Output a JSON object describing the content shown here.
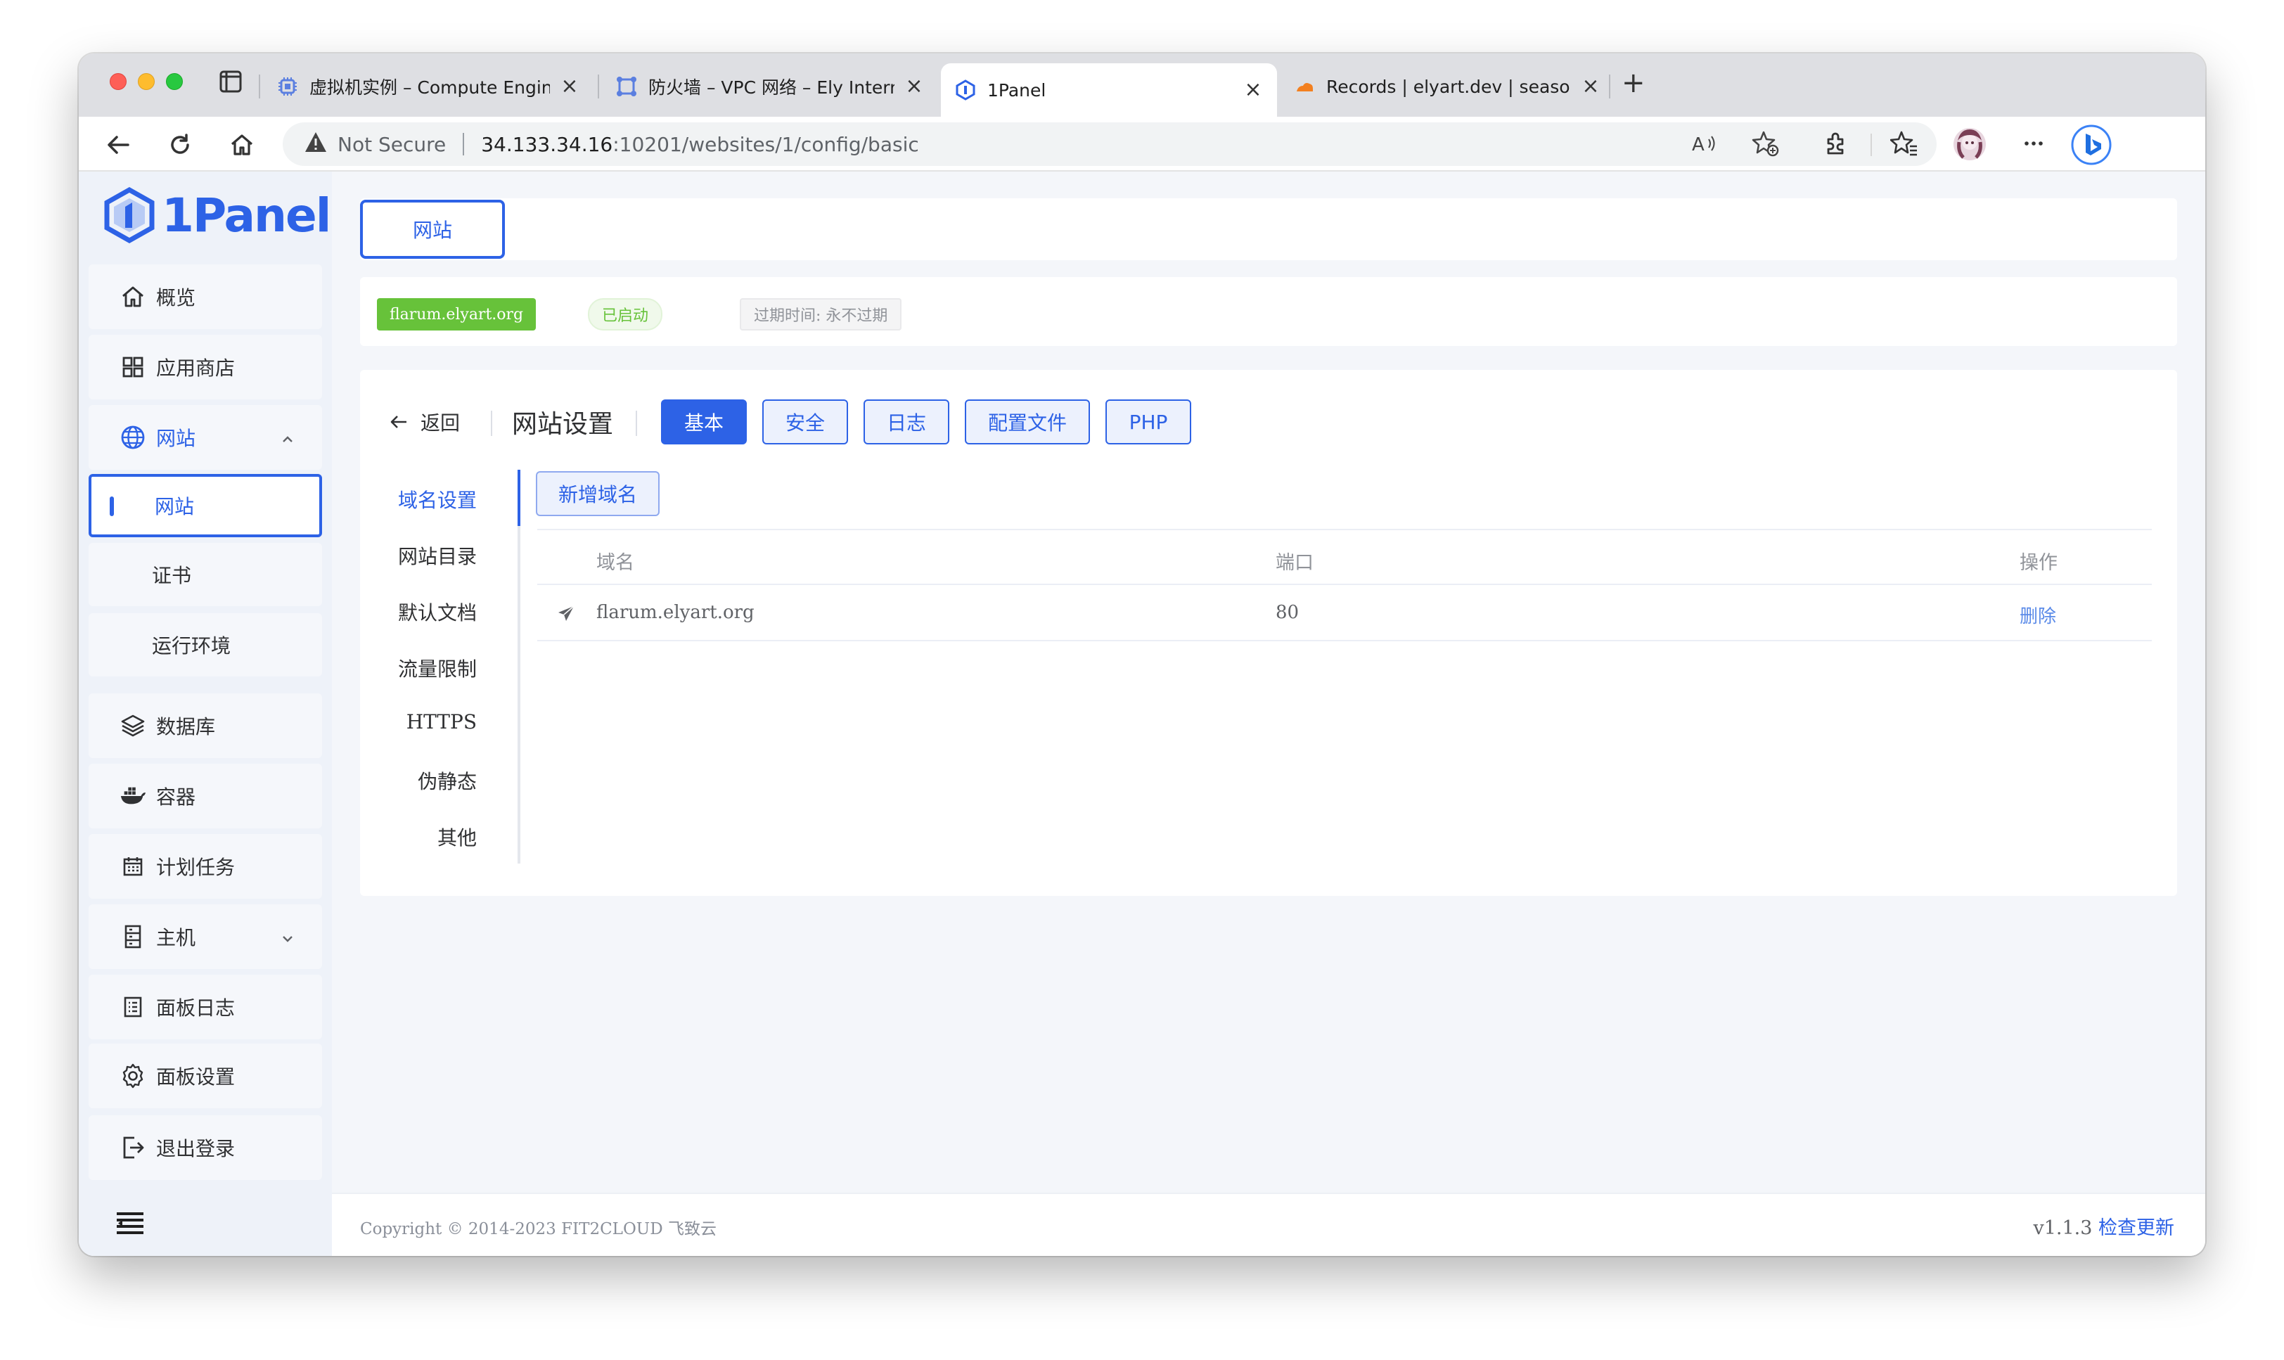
{
  "browser": {
    "tabs": [
      {
        "title": "虚拟机实例 – Compute Engine –",
        "icon": "compute-engine-icon"
      },
      {
        "title": "防火墙 – VPC 网络 – Ely Interna",
        "icon": "vpc-network-icon"
      },
      {
        "title": "1Panel",
        "icon": "1panel-icon"
      },
      {
        "title": "Records | elyart.dev | seasonsh",
        "icon": "cloudflare-icon"
      }
    ],
    "address": {
      "security_label": "Not Secure",
      "host": "34.133.34.16",
      "path": ":10201/websites/1/config/basic"
    }
  },
  "sidebar": {
    "logo_text": "1Panel",
    "items": [
      {
        "label": "概览",
        "icon": "home-icon"
      },
      {
        "label": "应用商店",
        "icon": "app-grid-icon"
      },
      {
        "label": "网站",
        "icon": "globe-icon"
      },
      {
        "label": "数据库",
        "icon": "database-layers-icon"
      },
      {
        "label": "容器",
        "icon": "docker-icon"
      },
      {
        "label": "计划任务",
        "icon": "calendar-icon"
      },
      {
        "label": "主机",
        "icon": "host-server-icon"
      },
      {
        "label": "面板日志",
        "icon": "log-list-icon"
      },
      {
        "label": "面板设置",
        "icon": "gear-icon"
      },
      {
        "label": "退出登录",
        "icon": "logout-icon"
      }
    ],
    "website_sub": [
      {
        "label": "网站"
      },
      {
        "label": "证书"
      },
      {
        "label": "运行环境"
      }
    ]
  },
  "top_tab": {
    "label": "网站"
  },
  "site_info": {
    "domain_tag": "flarum.elyart.org",
    "status": "已启动",
    "expire": "过期时间: 永不过期"
  },
  "settings": {
    "back_label": "返回",
    "title": "网站设置",
    "tabs": [
      "基本",
      "安全",
      "日志",
      "配置文件",
      "PHP"
    ],
    "side_nav": [
      "域名设置",
      "网站目录",
      "默认文档",
      "流量限制",
      "HTTPS",
      "伪静态",
      "其他"
    ],
    "add_domain_label": "新增域名",
    "table": {
      "headers": [
        "域名",
        "端口",
        "操作"
      ],
      "rows": [
        {
          "domain": "flarum.elyart.org",
          "port": "80",
          "action": "删除"
        }
      ]
    }
  },
  "footer": {
    "copyright": "Copyright © 2014-2023 FIT2CLOUD 飞致云",
    "version": "v1.1.3",
    "check_update": "检查更新"
  },
  "colors": {
    "primary": "#2d62e6",
    "success": "#67c23a",
    "sidebar_bg": "#eef2f9"
  }
}
